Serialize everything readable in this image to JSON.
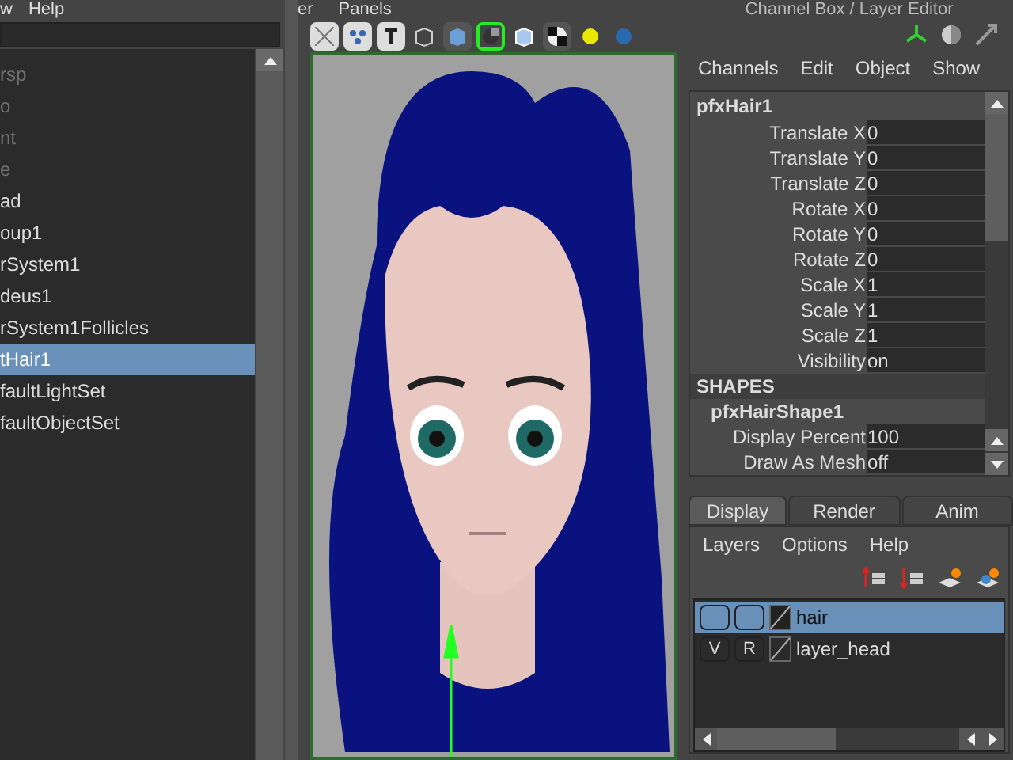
{
  "outliner": {
    "menu": [
      "w",
      "Help"
    ],
    "items": [
      {
        "label": "rsp",
        "dim": true,
        "selected": false
      },
      {
        "label": "o",
        "dim": true,
        "selected": false
      },
      {
        "label": "nt",
        "dim": true,
        "selected": false
      },
      {
        "label": "e",
        "dim": true,
        "selected": false
      },
      {
        "label": "ad",
        "dim": false,
        "selected": false
      },
      {
        "label": "oup1",
        "dim": false,
        "selected": false
      },
      {
        "label": "rSystem1",
        "dim": false,
        "selected": false
      },
      {
        "label": "deus1",
        "dim": false,
        "selected": false
      },
      {
        "label": "rSystem1Follicles",
        "dim": false,
        "selected": false
      },
      {
        "label": "tHair1",
        "dim": false,
        "selected": true
      },
      {
        "label": "faultLightSet",
        "dim": false,
        "selected": false
      },
      {
        "label": "faultObjectSet",
        "dim": false,
        "selected": false
      }
    ]
  },
  "viewport": {
    "menu": [
      "er",
      "Panels"
    ]
  },
  "channel_box": {
    "title": "Channel Box / Layer Editor",
    "menu": [
      "Channels",
      "Edit",
      "Object",
      "Show"
    ],
    "node": "pfxHair1",
    "attributes": [
      {
        "name": "Translate X",
        "value": "0"
      },
      {
        "name": "Translate Y",
        "value": "0"
      },
      {
        "name": "Translate Z",
        "value": "0"
      },
      {
        "name": "Rotate X",
        "value": "0"
      },
      {
        "name": "Rotate Y",
        "value": "0"
      },
      {
        "name": "Rotate Z",
        "value": "0"
      },
      {
        "name": "Scale X",
        "value": "1"
      },
      {
        "name": "Scale Y",
        "value": "1"
      },
      {
        "name": "Scale Z",
        "value": "1"
      },
      {
        "name": "Visibility",
        "value": "on"
      }
    ],
    "shapes_heading": "SHAPES",
    "shape_node": "pfxHairShape1",
    "shape_attributes": [
      {
        "name": "Display Percent",
        "value": "100"
      },
      {
        "name": "Draw As Mesh",
        "value": "off"
      }
    ]
  },
  "layer_editor": {
    "tabs": [
      {
        "label": "Display",
        "selected": true
      },
      {
        "label": "Render",
        "selected": false
      },
      {
        "label": "Anim",
        "selected": false
      }
    ],
    "menu": [
      "Layers",
      "Options",
      "Help"
    ],
    "layers": [
      {
        "name": "hair",
        "selected": true
      },
      {
        "name": "layer_head",
        "selected": false,
        "visible": "V",
        "reference": "R"
      }
    ]
  }
}
